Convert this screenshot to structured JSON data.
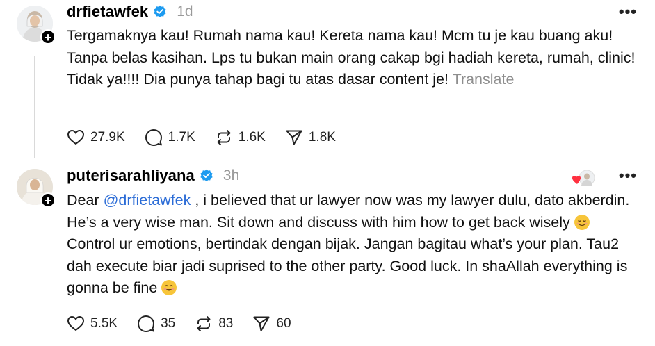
{
  "posts": [
    {
      "username": "drfietawfek",
      "time": "1d",
      "text": "Tergamaknya kau! Rumah nama kau! Kereta nama kau! Mcm tu je kau buang aku! Tanpa belas kasihan. Lps tu bukan main orang cakap bgi hadiah kereta, rumah, clinic! Tidak ya!!!! Dia punya tahap bagi tu atas dasar content je!",
      "translate_label": "Translate",
      "likes": "27.9K",
      "replies": "1.7K",
      "reposts": "1.6K",
      "shares": "1.8K"
    },
    {
      "username": "puterisarahliyana",
      "time": "3h",
      "text_pre": "Dear ",
      "mention": "@drfietawfek",
      "text_mid": " , i believed that ur lawyer now was my lawyer dulu, dato akberdin. He’s a very wise man. Sit down and discuss with him how to get back wisely ",
      "text_mid2": " Control ur emotions, bertindak dengan bijak. Jangan bagitau what’s your plan. Tau2 dah execute biar jadi suprised to the other party. Good luck. In shaAllah everything is gonna be fine ",
      "likes": "5.5K",
      "replies": "35",
      "reposts": "83",
      "shares": "60"
    }
  ],
  "colors": {
    "verified": "#1d9bf0",
    "mention": "#2a6bd6",
    "muted": "#999999"
  },
  "icons": [
    "heart-icon",
    "comment-icon",
    "repost-icon",
    "share-icon",
    "verified-icon",
    "plus-icon",
    "more-icon"
  ]
}
